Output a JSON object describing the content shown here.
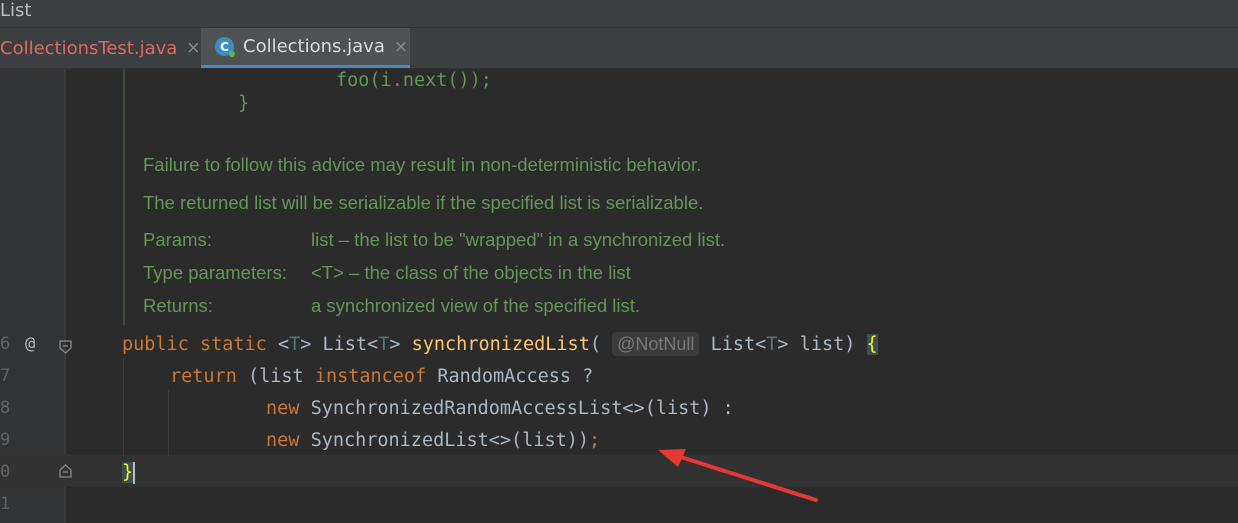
{
  "window": {
    "title": "List"
  },
  "tabs": [
    {
      "label": "CollectionsTest.java",
      "close": "×"
    },
    {
      "label": "Collections.java",
      "close": "×",
      "icon": "java-class-icon"
    }
  ],
  "code": {
    "snippet_line1": "foo(i.next());",
    "snippet_line2": "}",
    "doc": {
      "p1": "Failure to follow this advice may result in non-deterministic behavior.",
      "p2": "The returned list will be serializable if the specified list is serializable.",
      "params_label": "Params:",
      "params_value": "list – the list to be \"wrapped\" in a synchronized list.",
      "type_params_label": "Type parameters:",
      "type_params_value": "<T> – the class of the objects in the list",
      "returns_label": "Returns:",
      "returns_value": "a synchronized view of the specified list."
    },
    "line_numbers": [
      "6",
      "7",
      "8",
      "9",
      "0",
      "1"
    ],
    "decl": {
      "public": "public",
      "static": "static",
      "lt1": "<",
      "t1": "T",
      "gt1": ">",
      "list_type": "List<",
      "t2": "T",
      "gt2": ">",
      "name": "synchronizedList",
      "paren": "(",
      "annotation": "@NotNull",
      "param_type": "List<",
      "t3": "T",
      "param_rest": "> list)",
      "open_brace": "{"
    },
    "ret": {
      "keyword": "return",
      "pre": "(list",
      "instanceof": "instanceof",
      "post": "RandomAccess ?"
    },
    "line8": {
      "new": "new",
      "rest": "SynchronizedRandomAccessList<>(list) :"
    },
    "line9": {
      "new": "new",
      "rest": "SynchronizedList<>(list))",
      "semi": ";"
    },
    "close_brace": "}",
    "gutter_at": "@"
  },
  "colors": {
    "background": "#2b2b2b",
    "keyword": "#cc7832",
    "function": "#ffc66d",
    "doc": "#629755",
    "annotation_arrow": "#e53935"
  }
}
